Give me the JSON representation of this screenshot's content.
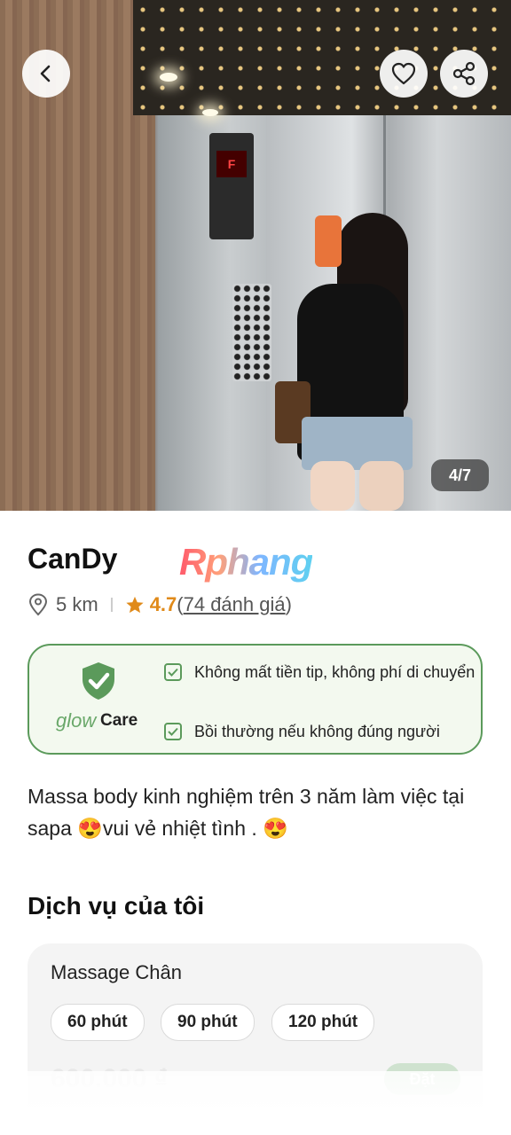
{
  "hero": {
    "photo_icon": "elevator-selfie-photo",
    "counter": "4/7",
    "back_icon": "chevron-left-icon",
    "favorite_icon": "heart-icon",
    "share_icon": "share-icon"
  },
  "profile": {
    "name": "CanDy",
    "brand_logo": "Rphang",
    "distance": "5 km",
    "rating": "4.7",
    "reviews": "74 đánh giá",
    "reviews_open": "(",
    "reviews_close": ")"
  },
  "glowcare": {
    "logo_glow": "glow",
    "logo_care": "Care",
    "items": [
      "Không mất tiền tip, không phí di chuyển",
      "Bồi thường nếu không đúng người"
    ]
  },
  "description": "Massa body kinh nghiệm trên 3 năm làm việc tại sapa 😍vui vẻ nhiệt tình . 😍",
  "services": {
    "title": "Dịch vụ của tôi",
    "items": [
      {
        "name": "Massage Chân",
        "durations": [
          "60 phút",
          "90 phút",
          "120 phút"
        ],
        "price": "600.000 ₫",
        "book_label": "Đặt"
      }
    ]
  },
  "colors": {
    "accent_green": "#5b9a5b",
    "rating_orange": "#e08a1a"
  }
}
